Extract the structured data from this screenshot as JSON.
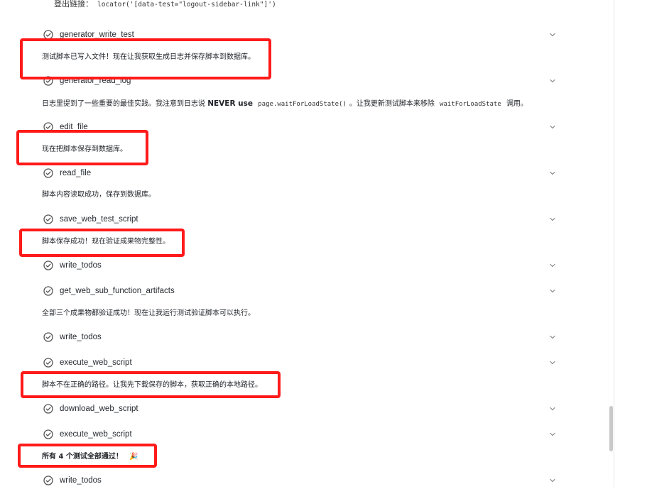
{
  "top": {
    "label": "登出链接：",
    "code": "locator('[data-test=\"logout-sidebar-link\"]')"
  },
  "items": {
    "t1": "generator_write_test",
    "m1": "测试脚本已写入文件！现在让我获取生成日志并保存脚本到数据库。",
    "t2": "generator_read_log",
    "m2_a": "日志里提到了一些重要的最佳实践。我注意到日志说",
    "m2_b": "NEVER use",
    "m2_c": "page.waitForLoadState()",
    "m2_d": "。让我更新测试脚本来移除",
    "m2_e": "waitForLoadState",
    "m2_f": "调用。",
    "t3": "edit_file",
    "m3": "现在把脚本保存到数据库。",
    "t4": "read_file",
    "m4": "脚本内容读取成功，保存到数据库。",
    "t5": "save_web_test_script",
    "m5": "脚本保存成功！现在验证成果物完整性。",
    "t6": "write_todos",
    "t7": "get_web_sub_function_artifacts",
    "m6": "全部三个成果物都验证成功！现在让我运行测试验证脚本可以执行。",
    "t8": "write_todos",
    "t9": "execute_web_script",
    "m7": "脚本不在正确的路径。让我先下载保存的脚本，获取正确的本地路径。",
    "t10": "download_web_script",
    "t11": "execute_web_script",
    "m8": "所有 4 个测试全部通过！",
    "m8_emoji": "🎉",
    "t12": "write_todos"
  },
  "icons": {
    "check": "check-circle-icon",
    "chevron": "chevron-down-icon"
  },
  "colors": {
    "highlight": "#ff1a1a",
    "icon": "#555555"
  }
}
